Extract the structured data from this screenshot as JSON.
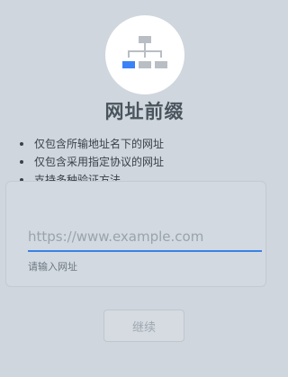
{
  "hero": {
    "icon": "sitemap-icon",
    "highlight_color": "#3b82f6",
    "node_color": "#b8bec4"
  },
  "title": "网址前缀",
  "features": [
    "仅包含所输地址名下的网址",
    "仅包含采用指定协议的网址",
    "支持多种验证方法"
  ],
  "url_form": {
    "placeholder": "https://www.example.com",
    "value": "",
    "hint": "请输入网址",
    "accent_color": "#3a82e6"
  },
  "continue_button": {
    "label": "继续",
    "state": "disabled"
  }
}
